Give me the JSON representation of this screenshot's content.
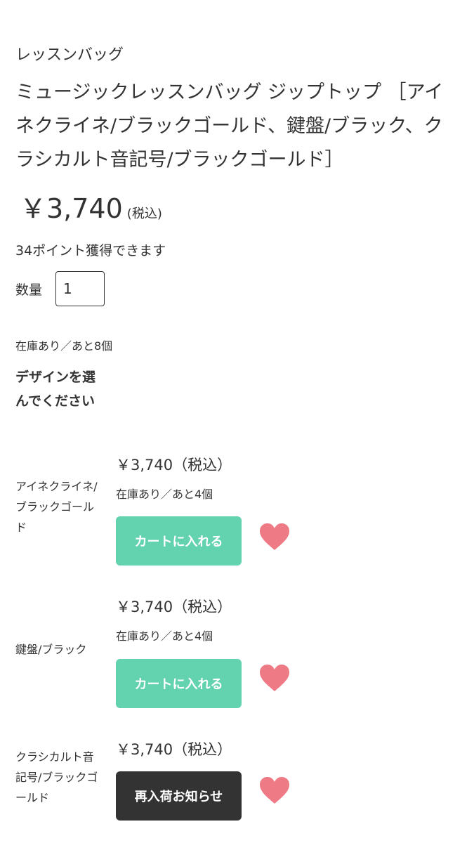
{
  "category": "レッスンバッグ",
  "title": "ミュージックレッスンバッグ ジップトップ ［アイネクライネ/ブラックゴールド、鍵盤/ブラック、クラシカルト音記号/ブラックゴールド］",
  "price": "￥3,740",
  "tax_label": "(税込)",
  "points": "34ポイント獲得できます",
  "quantity": {
    "label": "数量",
    "value": "1"
  },
  "stock": "在庫あり／あと8個",
  "design_heading": "デザインを選んでください",
  "colors": {
    "cart": "#63d2ae",
    "notify": "#333333",
    "heart": "#ee7a85"
  },
  "variants": [
    {
      "name": "アイネクライネ/ブラックゴールド",
      "price": "￥3,740（税込）",
      "stock": "在庫あり／あと4個",
      "button": "カートに入れる",
      "favorite_icon": "heart-icon"
    },
    {
      "name": "鍵盤/ブラック",
      "price": "￥3,740（税込）",
      "stock": "在庫あり／あと4個",
      "button": "カートに入れる",
      "favorite_icon": "heart-icon"
    },
    {
      "name": "クラシカルト音記号/ブラックゴールド",
      "price": "￥3,740（税込）",
      "button": "再入荷お知らせ",
      "favorite_icon": "heart-icon"
    }
  ]
}
